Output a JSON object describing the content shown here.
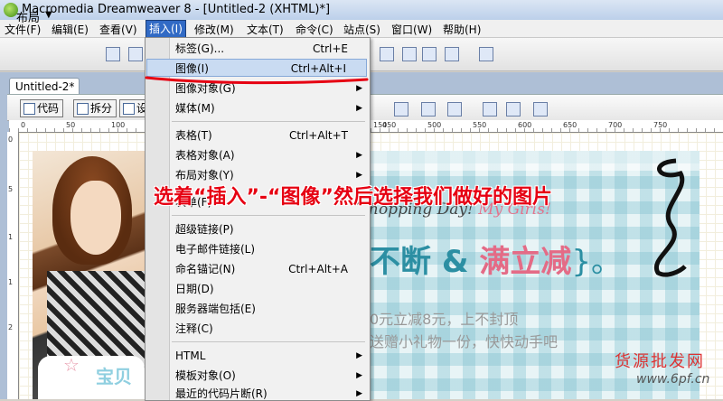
{
  "window": {
    "title": "Macromedia Dreamweaver 8 - [Untitled-2 (XHTML)*]"
  },
  "menubar": [
    {
      "label": "文件(F)"
    },
    {
      "label": "编辑(E)"
    },
    {
      "label": "查看(V)"
    },
    {
      "label": "插入(I)"
    },
    {
      "label": "修改(M)"
    },
    {
      "label": "文本(T)"
    },
    {
      "label": "命令(C)"
    },
    {
      "label": "站点(S)"
    },
    {
      "label": "窗口(W)"
    },
    {
      "label": "帮助(H)"
    }
  ],
  "toolbar": {
    "layout_label": "布局"
  },
  "document": {
    "tab_label": "Untitled-2*",
    "view_code": "代码",
    "view_split": "拆分",
    "view_design": "设"
  },
  "ruler": {
    "top": [
      "0",
      "50",
      "100",
      "150",
      "450",
      "500",
      "550",
      "600",
      "650",
      "700",
      "750"
    ],
    "left": [
      "0",
      "5",
      "1",
      "1",
      "2"
    ]
  },
  "insert_menu": {
    "items": [
      {
        "label": "标签(G)...",
        "shortcut": "Ctrl+E",
        "submenu": false
      },
      {
        "label": "图像(I)",
        "shortcut": "Ctrl+Alt+I",
        "submenu": false,
        "highlighted": true
      },
      {
        "label": "图像对象(G)",
        "shortcut": "",
        "submenu": true
      },
      {
        "label": "媒体(M)",
        "shortcut": "",
        "submenu": true
      },
      {
        "label": "表格(T)",
        "shortcut": "Ctrl+Alt+T",
        "submenu": false
      },
      {
        "label": "表格对象(A)",
        "shortcut": "",
        "submenu": true
      },
      {
        "label": "布局对象(Y)",
        "shortcut": "",
        "submenu": true
      },
      {
        "label": "表单(F)",
        "shortcut": "",
        "submenu": true
      },
      {
        "label": "超级链接(P)",
        "shortcut": "",
        "submenu": false
      },
      {
        "label": "电子邮件链接(L)",
        "shortcut": "",
        "submenu": false
      },
      {
        "label": "命名锚记(N)",
        "shortcut": "Ctrl+Alt+A",
        "submenu": false
      },
      {
        "label": "日期(D)",
        "shortcut": "",
        "submenu": false
      },
      {
        "label": "服务器端包括(E)",
        "shortcut": "",
        "submenu": false
      },
      {
        "label": "注释(C)",
        "shortcut": "",
        "submenu": false
      },
      {
        "label": "HTML",
        "shortcut": "",
        "submenu": true
      },
      {
        "label": "模板对象(O)",
        "shortcut": "",
        "submenu": true
      },
      {
        "label": "最近的代码片断(R)",
        "shortcut": "",
        "submenu": true
      }
    ]
  },
  "banner": {
    "shopping_day": "hopping Day! ",
    "my_girls": "My Girls!",
    "slogan_a": "不断",
    "slogan_amp": " & ",
    "slogan_b": "满立减",
    "slogan_end": "}。",
    "promo_line1": "0元立减8元，上不封顶",
    "promo_line2": "送赠小礼物一份，快快动手吧",
    "baby_text": "宝贝"
  },
  "annotation": {
    "text": "选着“插入”-“图像”然后选择我们做好的图片",
    "color": "#e60012"
  },
  "watermark": {
    "cn": "货源批发网",
    "url": "www.6pf.cn"
  },
  "colors": {
    "menu_highlight": "#c9dbf2",
    "annotation_red": "#e60012",
    "accent_teal": "#2c8fa3",
    "accent_pink": "#e46b86"
  }
}
